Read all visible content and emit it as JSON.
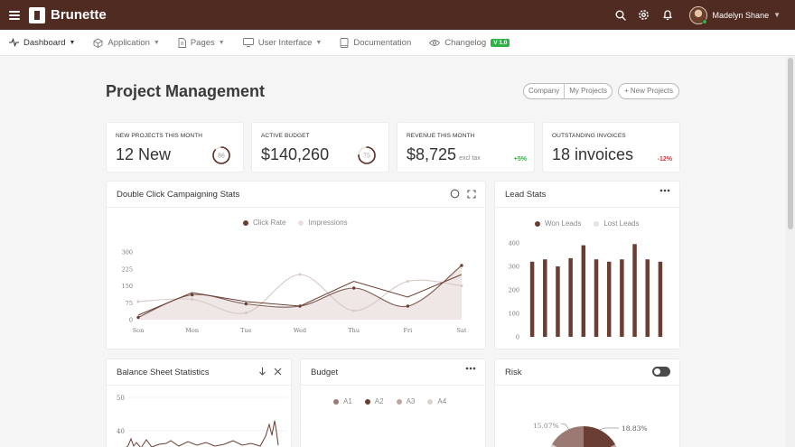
{
  "brand": {
    "name": "Brunette"
  },
  "user": {
    "name": "Madelyn Shane"
  },
  "colors": {
    "primary": "#4f2b22",
    "accent": "#6b3e33",
    "success": "#2fb344",
    "danger": "#d63939"
  },
  "nav": [
    {
      "label": "Dashboard",
      "icon": "activity-icon"
    },
    {
      "label": "Application",
      "icon": "package-icon"
    },
    {
      "label": "Pages",
      "icon": "file-icon"
    },
    {
      "label": "User Interface",
      "icon": "monitor-icon"
    },
    {
      "label": "Documentation",
      "icon": "book-icon"
    },
    {
      "label": "Changelog",
      "icon": "eye-icon",
      "badge": "V 1.0"
    }
  ],
  "page": {
    "title": "Project Management",
    "btn_company": "Company",
    "btn_my_projects": "My Projects",
    "btn_new_projects": "+ New Projects"
  },
  "stats": [
    {
      "label": "NEW PROJECTS THIS MONTH",
      "value": "12 New",
      "ring_value": "86",
      "ring_fraction": 0.86
    },
    {
      "label": "ACTIVE BUDGET",
      "value": "$140,260",
      "ring_value": "75",
      "ring_fraction": 0.75
    },
    {
      "label": "REVENUE THIS MONTH",
      "value": "$8,725",
      "sub": "excl tax",
      "change": "+5%"
    },
    {
      "label": "OUTSTANDING INVOICES",
      "value": "18 invoices",
      "change": "-12%"
    }
  ],
  "campaign": {
    "title": "Double Click Campaigning Stats"
  },
  "lead": {
    "title": "Lead Stats"
  },
  "balance": {
    "title": "Balance Sheet Statistics",
    "y_labels": [
      "50",
      "40"
    ]
  },
  "budget": {
    "title": "Budget"
  },
  "risk": {
    "title": "Risk",
    "pie_labels": [
      "15.07%",
      "18.83%"
    ]
  },
  "chart_data": [
    {
      "type": "area",
      "series": [
        {
          "name": "Click Rate",
          "values": [
            10,
            110,
            70,
            60,
            140,
            60,
            240
          ]
        },
        {
          "name": "Impressions",
          "values": [
            80,
            90,
            30,
            200,
            40,
            170,
            150
          ]
        }
      ],
      "categories": [
        "Son",
        "Mon",
        "Tue",
        "Wed",
        "Thu",
        "Fri",
        "Sat"
      ],
      "yticks": [
        "300",
        "225",
        "150",
        "75",
        "0"
      ],
      "ylim": [
        0,
        300
      ]
    },
    {
      "type": "bar",
      "series": [
        {
          "name": "Won Leads",
          "values": [
            320,
            330,
            300,
            335,
            390,
            330,
            320,
            330,
            395,
            330,
            320
          ]
        },
        {
          "name": "Lost Leads",
          "values": []
        }
      ],
      "yticks": [
        "400",
        "300",
        "200",
        "100",
        "0"
      ],
      "ylim": [
        0,
        400
      ]
    },
    {
      "type": "bar",
      "series": [
        {
          "name": "A1",
          "values": []
        },
        {
          "name": "A2",
          "values": []
        },
        {
          "name": "A3",
          "values": []
        },
        {
          "name": "A4",
          "values": []
        }
      ]
    }
  ]
}
